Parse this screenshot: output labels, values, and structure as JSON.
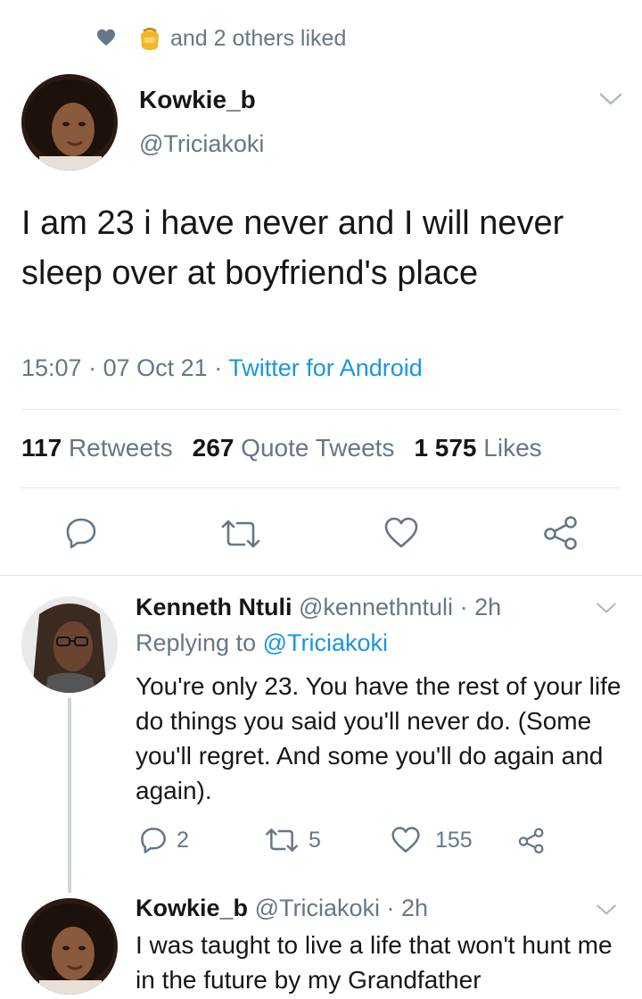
{
  "liked_bar": {
    "text": "and 2 others liked"
  },
  "tweet": {
    "author_name": "Kowkie_b",
    "author_handle": "@Triciakoki",
    "text": "I am 23 i have never and I will never sleep over at boyfriend's place",
    "time": "15:07",
    "separator": "·",
    "date": "07 Oct 21",
    "source": "Twitter for Android",
    "retweets_count": "117",
    "retweets_label": "Retweets",
    "quotes_count": "267",
    "quotes_label": "Quote Tweets",
    "likes_count": "1 575",
    "likes_label": "Likes"
  },
  "replies": [
    {
      "name": "Kenneth Ntuli",
      "handle": "@kennethntuli",
      "time": "2h",
      "replying_prefix": "Replying to",
      "replying_to": "@Triciakoki",
      "text": "You're only 23. You have the rest of your life do things you said you'll never do. (Some you'll regret. And some you'll do again and again).",
      "reply_count": "2",
      "retweet_count": "5",
      "like_count": "155"
    },
    {
      "name": "Kowkie_b",
      "handle": "@Triciakoki",
      "time": "2h",
      "text": "I was taught to live a life that  won't hunt me in the future by my Grandfather"
    }
  ],
  "icons": {
    "liked_heart": "heart-icon",
    "chevron": "chevron-down-icon",
    "reply": "reply-icon",
    "retweet": "retweet-icon",
    "like": "like-icon",
    "share": "share-icon"
  },
  "colors": {
    "text": "#14171a",
    "muted": "#657786",
    "link": "#1b95e0",
    "divider": "#e1e8ed",
    "thread_line": "#ccd6dd"
  }
}
